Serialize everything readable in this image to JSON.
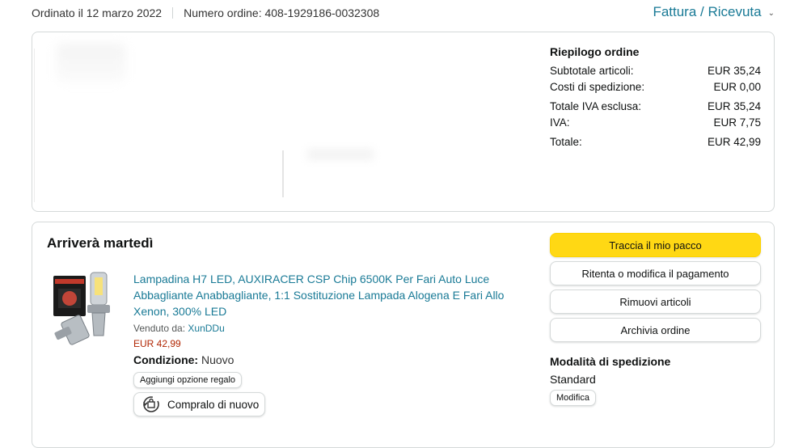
{
  "header": {
    "ordered": "Ordinato il 12 marzo 2022",
    "order_number": "Numero ordine: 408-1929186-0032308",
    "invoice_link": "Fattura / Ricevuta"
  },
  "summary": {
    "title": "Riepilogo ordine",
    "rows": [
      {
        "label": "Subtotale articoli:",
        "value": "EUR 35,24"
      },
      {
        "label": "Costi di spedizione:",
        "value": "EUR 0,00"
      },
      {
        "label": "Totale IVA esclusa:",
        "value": "EUR 35,24"
      },
      {
        "label": "IVA:",
        "value": "EUR 7,75"
      },
      {
        "label": "Totale:",
        "value": "EUR 42,99"
      }
    ]
  },
  "shipment": {
    "arrival": "Arriverà martedì",
    "product": {
      "title": "Lampadina H7 LED, AUXIRACER CSP Chip 6500K Per Fari Auto Luce Abbagliante Anabbagliante, 1:1 Sostituzione Lampada Alogena E Fari Allo Xenon, 300% LED",
      "seller_label": "Venduto da:",
      "seller": "XunDDu",
      "price": "EUR 42,99",
      "condition_label": "Condizione:",
      "condition": "Nuovo",
      "gift_button": "Aggiungi opzione regalo",
      "rebuy_button": "Compralo di nuovo"
    },
    "actions": {
      "track": "Traccia il mio pacco",
      "retry_payment": "Ritenta o modifica il pagamento",
      "remove_items": "Rimuovi articoli",
      "archive": "Archivia ordine"
    },
    "shipping": {
      "title": "Modalità di spedizione",
      "value": "Standard",
      "modify": "Modifica"
    }
  },
  "colors": {
    "link": "#197a96",
    "price": "#b12704",
    "primary_button": "#ffd814",
    "border": "#d5d9d9"
  }
}
